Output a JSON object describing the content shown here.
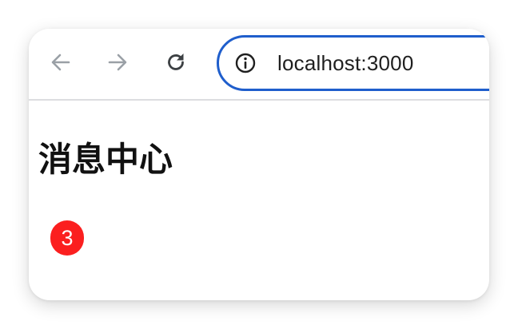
{
  "browser": {
    "address_bar": {
      "url": "localhost:3000"
    },
    "icons": {
      "back": "arrow-left-icon",
      "forward": "arrow-right-icon",
      "reload": "reload-icon",
      "site_info": "info-icon"
    },
    "colors": {
      "omnibox_border": "#1f5ecc",
      "nav_disabled": "#9aa0a6",
      "nav_active": "#3c4043"
    }
  },
  "page": {
    "title": "消息中心",
    "badge": {
      "count": "3",
      "color": "#fb1f1f"
    }
  }
}
